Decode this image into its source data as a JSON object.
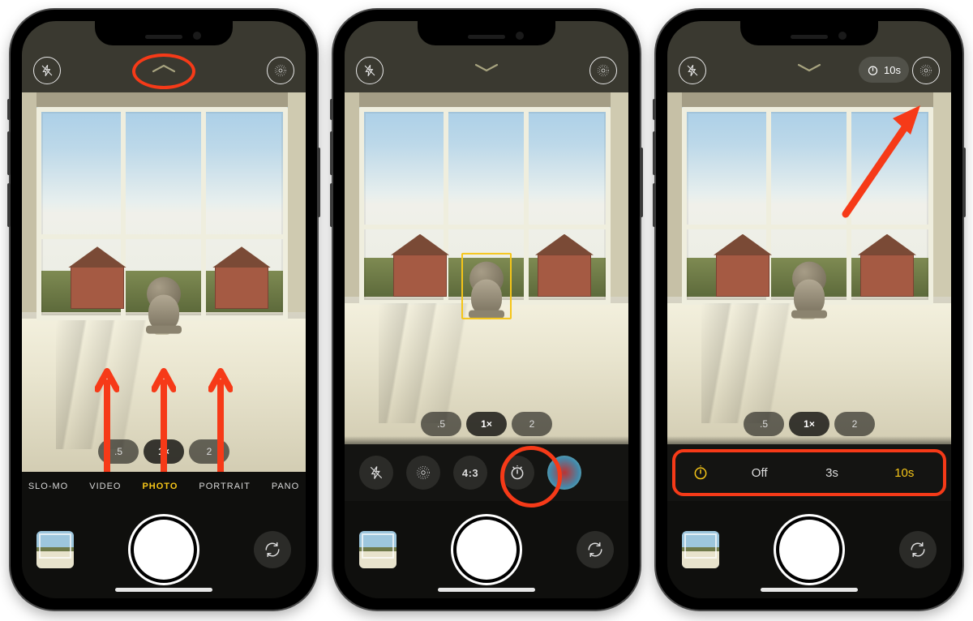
{
  "zoom": {
    "options": [
      ".5",
      "1×",
      "2"
    ],
    "selected": "1×"
  },
  "modes": [
    "SLO-MO",
    "VIDEO",
    "PHOTO",
    "PORTRAIT",
    "PANO"
  ],
  "modes_selected": "PHOTO",
  "tray": {
    "aspect": "4:3"
  },
  "timer": {
    "options": [
      "Off",
      "3s",
      "10s"
    ],
    "selected": "10s",
    "badge": "10s"
  },
  "icons": {
    "flash": "flash-off-icon",
    "chevron_up": "chevron-up-icon",
    "chevron_down": "chevron-down-icon",
    "live": "live-photo-icon",
    "timer": "timer-icon",
    "flip": "flip-camera-icon",
    "filters": "filters-icon"
  }
}
